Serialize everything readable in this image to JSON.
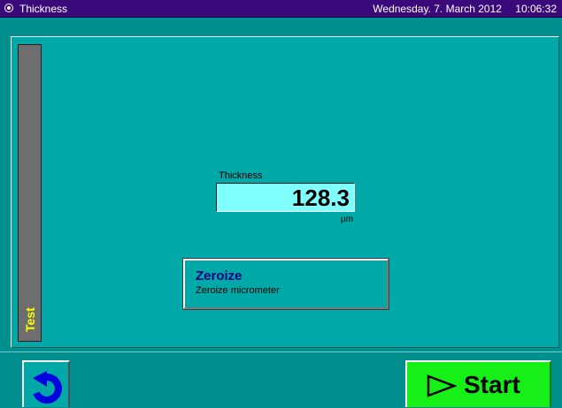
{
  "window": {
    "title": "Thickness",
    "date": "Wednesday. 7. March 2012",
    "time": "10:06:32",
    "title_icon": "radio-dot-icon"
  },
  "side_panel": {
    "label": "Test"
  },
  "measurement": {
    "label": "Thickness",
    "value": "128.3",
    "unit": "µm"
  },
  "zeroize": {
    "title": "Zeroize",
    "subtitle": "Zeroize micrometer"
  },
  "footer": {
    "back_icon": "undo-arrow-icon",
    "start_icon": "play-outline-icon",
    "start_label": "Start"
  },
  "colors": {
    "titlebar": "#3a0a7a",
    "background": "#00a8a8",
    "value_box": "#80ffff",
    "start_button": "#16f016",
    "side_label": "#ffff00",
    "zeroize_title": "#000080",
    "back_icon": "#0000e0"
  }
}
